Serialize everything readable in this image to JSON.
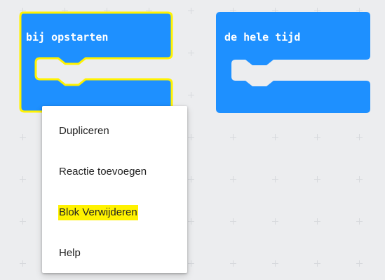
{
  "workspace": {
    "background": "#ecedef"
  },
  "blocks": [
    {
      "label": "bij opstarten",
      "color": "#1e90ff",
      "selected": true,
      "selection_outline_color": "#fff200"
    },
    {
      "label": "de hele tijd",
      "color": "#1e90ff",
      "selected": false
    }
  ],
  "context_menu": {
    "items": [
      {
        "label": "Dupliceren",
        "highlighted": false
      },
      {
        "label": "Reactie toevoegen",
        "highlighted": false
      },
      {
        "label": "Blok Verwijderen",
        "highlighted": true
      },
      {
        "label": "Help",
        "highlighted": false
      }
    ],
    "highlight_color": "#fff200"
  }
}
